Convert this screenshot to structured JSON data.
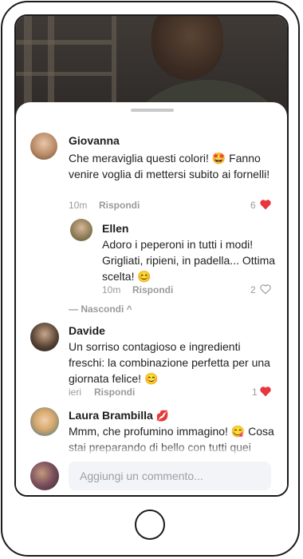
{
  "comments": [
    {
      "author": "Giovanna",
      "text": "Che meraviglia questi colori! 🤩 Fanno venire voglia di mettersi subito ai fornelli!",
      "time": "10m",
      "reply_label": "Rispondi",
      "like_count": "6",
      "liked": true
    },
    {
      "author": "Ellen",
      "text": "Adoro i peperoni in tutti i modi! Grigliati, ripieni, in padella... Ottima scelta! 😊",
      "time": "10m",
      "reply_label": "Rispondi",
      "like_count": "2",
      "liked": false
    },
    {
      "author": "Davide",
      "text": "Un sorriso contagioso e ingredienti freschi: la combinazione perfetta per una giornata felice! 😊",
      "time": "ieri",
      "reply_label": "Rispondi",
      "like_count": "1",
      "liked": true
    },
    {
      "author": "Laura Brambilla",
      "author_badge": "💋",
      "text": "Mmm, che profumino immagino! 😋 Cosa stai preparando di bello con tutti quei",
      "time": "",
      "reply_label": "",
      "like_count": "",
      "liked": false
    }
  ],
  "hide_replies_label": "— Nascondi ^",
  "composer": {
    "placeholder": "Aggiungi un commento..."
  },
  "colors": {
    "heart": "#e8353e",
    "muted": "#9a9a9a"
  }
}
